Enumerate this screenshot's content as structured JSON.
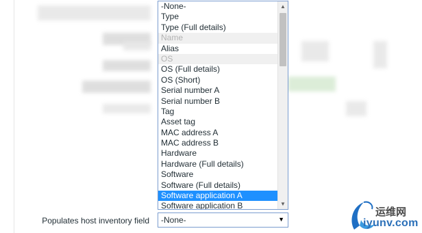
{
  "dropdown": {
    "options": [
      {
        "label": "-None-",
        "state": "normal"
      },
      {
        "label": "Type",
        "state": "normal"
      },
      {
        "label": "Type (Full details)",
        "state": "normal"
      },
      {
        "label": "Name",
        "state": "disabled"
      },
      {
        "label": "Alias",
        "state": "normal"
      },
      {
        "label": "OS",
        "state": "disabled"
      },
      {
        "label": "OS (Full details)",
        "state": "normal"
      },
      {
        "label": "OS (Short)",
        "state": "normal"
      },
      {
        "label": "Serial number A",
        "state": "normal"
      },
      {
        "label": "Serial number B",
        "state": "normal"
      },
      {
        "label": "Tag",
        "state": "normal"
      },
      {
        "label": "Asset tag",
        "state": "normal"
      },
      {
        "label": "MAC address A",
        "state": "normal"
      },
      {
        "label": "MAC address B",
        "state": "normal"
      },
      {
        "label": "Hardware",
        "state": "normal"
      },
      {
        "label": "Hardware (Full details)",
        "state": "normal"
      },
      {
        "label": "Software",
        "state": "normal"
      },
      {
        "label": "Software (Full details)",
        "state": "normal"
      },
      {
        "label": "Software application A",
        "state": "selected"
      },
      {
        "label": "Software application B",
        "state": "normal"
      }
    ],
    "highlight_color": "#1e90ff"
  },
  "form": {
    "field_label": "Populates host inventory field",
    "select_value": "-None-"
  },
  "watermark": {
    "cn_text": "运维网",
    "domain_text": "iyunv.com"
  },
  "icons": {
    "scroll_up": "▲",
    "scroll_down": "▼",
    "select_arrow": "▼"
  }
}
